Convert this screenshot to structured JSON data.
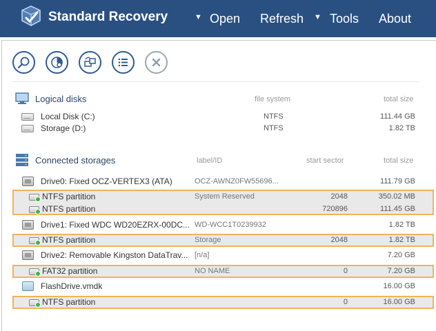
{
  "header": {
    "title": "Standard Recovery",
    "menu": [
      {
        "label": "Open",
        "has_dropdown": true
      },
      {
        "label": "Refresh",
        "has_dropdown": false
      },
      {
        "label": "Tools",
        "has_dropdown": true
      },
      {
        "label": "About",
        "has_dropdown": false
      }
    ],
    "dropdown_glyph": "▼",
    "colors": {
      "header_bg": "#2a5082",
      "accent": "#f0b35a"
    }
  },
  "toolbar": {
    "buttons": [
      "search-icon",
      "scan-icon",
      "convert-icon",
      "list-icon",
      "close-icon"
    ]
  },
  "logical_disks": {
    "title": "Logical disks",
    "columns": {
      "file_system": "file system",
      "total_size": "total size"
    },
    "rows": [
      {
        "name": "Local Disk (C:)",
        "file_system": "NTFS",
        "total_size": "111.44 GB"
      },
      {
        "name": "Storage (D:)",
        "file_system": "NTFS",
        "total_size": "1.82 TB"
      }
    ]
  },
  "connected_storages": {
    "title": "Connected storages",
    "columns": {
      "label": "label/ID",
      "start_sector": "start sector",
      "total_size": "total size"
    },
    "drives": [
      {
        "name": "Drive0: Fixed OCZ-VERTEX3 (ATA)",
        "label": "OCZ-AWNZ0FW55696...",
        "total_size": "111.79 GB",
        "icon": "hdd-icon",
        "partitions": [
          {
            "name": "NTFS partition",
            "label": "System Reserved",
            "start_sector": "2048",
            "total_size": "350.02 MB"
          },
          {
            "name": "NTFS partition",
            "label": "",
            "start_sector": "720896",
            "total_size": "111.45 GB"
          }
        ]
      },
      {
        "name": "Drive1: Fixed WDC WD20EZRX-00DC...",
        "label": "WD-WCC1T0239932",
        "total_size": "1.82 TB",
        "icon": "hdd-icon",
        "partitions": [
          {
            "name": "NTFS partition",
            "label": "Storage",
            "start_sector": "2048",
            "total_size": "1.82 TB"
          }
        ]
      },
      {
        "name": "Drive2: Removable Kingston DataTrav...",
        "label": "[n/a]",
        "total_size": "7.20 GB",
        "icon": "usb-drive-icon",
        "partitions": [
          {
            "name": "FAT32 partition",
            "label": "NO NAME",
            "start_sector": "0",
            "total_size": "7.20 GB"
          }
        ]
      },
      {
        "name": "FlashDrive.vmdk",
        "label": "",
        "total_size": "16.00 GB",
        "icon": "vmdk-icon",
        "partitions": [
          {
            "name": "NTFS partition",
            "label": "",
            "start_sector": "0",
            "total_size": "16.00 GB"
          }
        ]
      }
    ]
  }
}
